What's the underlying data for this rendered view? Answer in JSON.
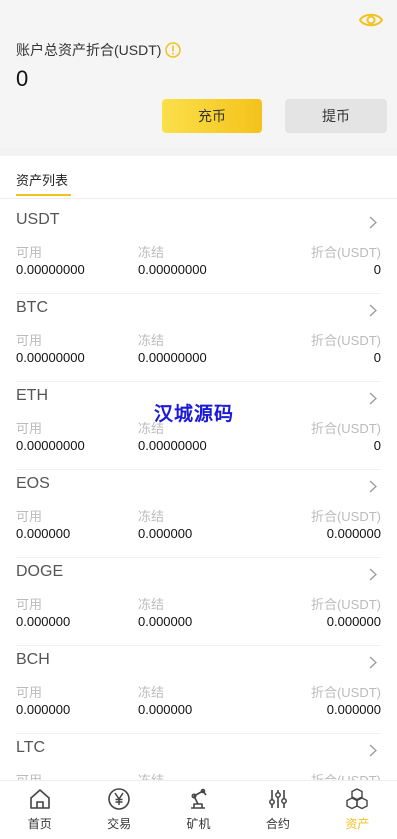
{
  "header": {
    "total_label": "账户总资产折合(USDT)",
    "total_value": "0",
    "deposit_label": "充币",
    "withdraw_label": "提币"
  },
  "tabs": {
    "asset_list": "资产列表"
  },
  "labels": {
    "available": "可用",
    "frozen": "冻结",
    "converted": "折合(USDT)"
  },
  "assets": [
    {
      "name": "USDT",
      "available": "0.00000000",
      "frozen": "0.00000000",
      "converted": "0"
    },
    {
      "name": "BTC",
      "available": "0.00000000",
      "frozen": "0.00000000",
      "converted": "0"
    },
    {
      "name": "ETH",
      "available": "0.00000000",
      "frozen": "0.00000000",
      "converted": "0"
    },
    {
      "name": "EOS",
      "available": "0.000000",
      "frozen": "0.000000",
      "converted": "0.000000"
    },
    {
      "name": "DOGE",
      "available": "0.000000",
      "frozen": "0.000000",
      "converted": "0.000000"
    },
    {
      "name": "BCH",
      "available": "0.000000",
      "frozen": "0.000000",
      "converted": "0.000000"
    },
    {
      "name": "LTC",
      "available": "",
      "frozen": "",
      "converted": ""
    }
  ],
  "watermark": "汉城源码",
  "nav": [
    {
      "label": "首页",
      "icon": "home-icon"
    },
    {
      "label": "交易",
      "icon": "yen-coin-icon"
    },
    {
      "label": "矿机",
      "icon": "robot-arm-icon"
    },
    {
      "label": "合约",
      "icon": "sliders-icon"
    },
    {
      "label": "资产",
      "icon": "cubes-icon",
      "active": true
    }
  ],
  "colors": {
    "accent": "#f2c21e",
    "watermark": "#1a1ad8"
  }
}
